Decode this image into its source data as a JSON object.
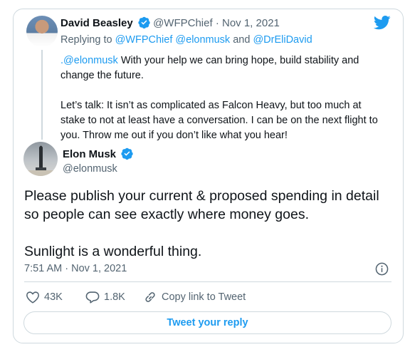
{
  "colors": {
    "accent": "#1d9bf0",
    "muted": "#536471",
    "text": "#0f1419",
    "border": "#cfd9de"
  },
  "reply_tweet": {
    "name": "David Beasley",
    "handle": "@WFPChief",
    "separator": "·",
    "date": "Nov 1, 2021",
    "replying_prefix": "Replying to",
    "replying_handle_1": "@WFPChief",
    "replying_handle_2": "@elonmusk",
    "replying_and": "and",
    "replying_handle_3": "@DrEliDavid",
    "body_prefix": ".",
    "body_mention": "@elonmusk",
    "body_line1_rest": " With your help we can bring hope, build stability and change the future.",
    "body_para2": "Let’s talk: It isn’t as complicated as Falcon Heavy, but too much at stake to not at least have a conversation. I can be on the next flight to you. Throw me out if you don’t like what you hear!",
    "avatar_icon": "avatar-photo",
    "verified_icon": "verified-badge-icon"
  },
  "main_tweet": {
    "name": "Elon Musk",
    "handle": "@elonmusk",
    "body_para1": "Please publish your current & proposed spending in detail so people can see exactly where money goes.",
    "body_para2": "Sunlight is a wonderful thing.",
    "time": "7:51 AM",
    "separator": "·",
    "date": "Nov 1, 2021",
    "avatar_icon": "avatar-photo",
    "verified_icon": "verified-badge-icon",
    "info_icon": "info-icon"
  },
  "actions": {
    "likes": "43K",
    "replies": "1.8K",
    "copy_link_label": "Copy link to Tweet",
    "like_icon": "heart-icon",
    "reply_icon": "comment-icon",
    "link_icon": "link-icon"
  },
  "reply_button_label": "Tweet your reply",
  "brand_icon": "twitter-bird-icon"
}
